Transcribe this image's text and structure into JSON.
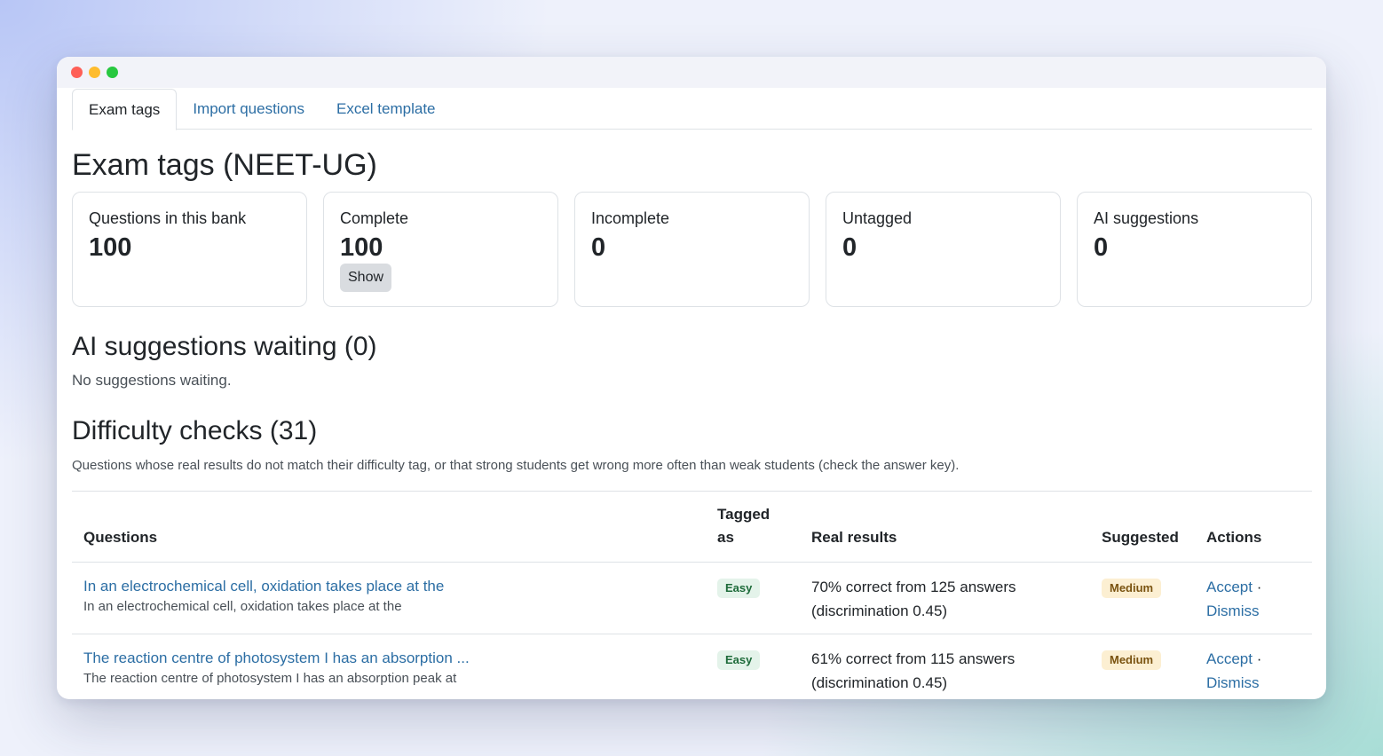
{
  "tabs": [
    {
      "label": "Exam tags",
      "active": true
    },
    {
      "label": "Import questions",
      "active": false
    },
    {
      "label": "Excel template",
      "active": false
    }
  ],
  "page_title": "Exam tags (NEET-UG)",
  "stats": [
    {
      "label": "Questions in this bank",
      "value": "100"
    },
    {
      "label": "Complete",
      "value": "100",
      "button": "Show"
    },
    {
      "label": "Incomplete",
      "value": "0"
    },
    {
      "label": "Untagged",
      "value": "0"
    },
    {
      "label": "AI suggestions",
      "value": "0"
    }
  ],
  "ai_section": {
    "title": "AI suggestions waiting (0)",
    "empty_text": "No suggestions waiting."
  },
  "difficulty": {
    "title": "Difficulty checks (31)",
    "description": "Questions whose real results do not match their difficulty tag, or that strong students get wrong more often than weak students (check the answer key).",
    "columns": {
      "questions": "Questions",
      "tagged_as": "Tagged as",
      "real_results": "Real results",
      "suggested": "Suggested",
      "actions": "Actions"
    },
    "rows": [
      {
        "question_link": "In an electrochemical cell, oxidation takes place at the",
        "question_text": "In an electrochemical cell, oxidation takes place at the",
        "tagged": "Easy",
        "result_line1": "70% correct from 125 answers",
        "result_line2": "(discrimination 0.45)",
        "suggested": "Medium",
        "accept": "Accept",
        "separator": "·",
        "dismiss": "Dismiss"
      },
      {
        "question_link": "The reaction centre of photosystem I has an absorption ...",
        "question_text": "The reaction centre of photosystem I has an absorption peak at",
        "tagged": "Easy",
        "result_line1": "61% correct from 115 answers",
        "result_line2": "(discrimination 0.45)",
        "suggested": "Medium",
        "accept": "Accept",
        "separator": "·",
        "dismiss": "Dismiss"
      }
    ]
  },
  "colors": {
    "link": "#2c6ea4",
    "easy_badge_bg": "#e4f3ea",
    "medium_badge_bg": "#fcefd2"
  }
}
